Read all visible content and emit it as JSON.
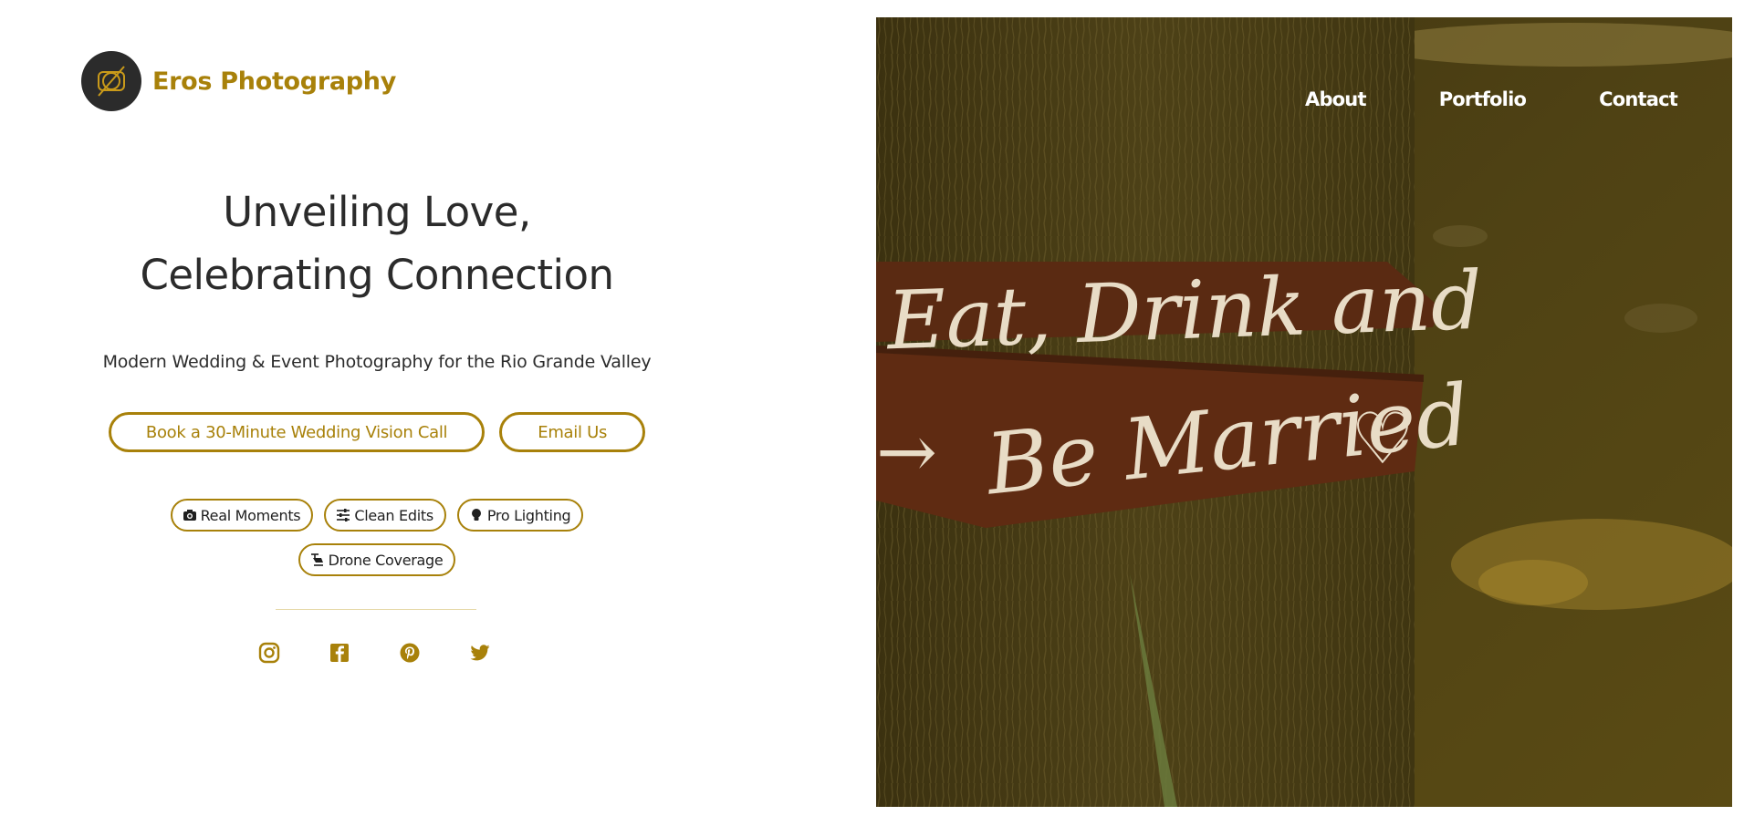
{
  "brand": {
    "name": "Eros Photography",
    "logo_icon": "camera-aperture-icon"
  },
  "hero": {
    "title_line1": "Unveiling Love,",
    "title_line2": "Celebrating Connection",
    "subtitle": "Modern Wedding & Event Photography for the Rio Grande Valley"
  },
  "cta": {
    "primary_label": "Book a 30-Minute Wedding Vision Call",
    "secondary_label": "Email Us"
  },
  "features": [
    {
      "label": "Real Moments",
      "icon": "camera-icon"
    },
    {
      "label": "Clean Edits",
      "icon": "sliders-icon"
    },
    {
      "label": "Pro Lighting",
      "icon": "lightbulb-icon"
    },
    {
      "label": "Drone Coverage",
      "icon": "drone-icon"
    }
  ],
  "social": [
    {
      "network": "Instagram",
      "icon": "instagram-icon"
    },
    {
      "network": "Facebook",
      "icon": "facebook-icon"
    },
    {
      "network": "Pinterest",
      "icon": "pinterest-icon"
    },
    {
      "network": "Twitter",
      "icon": "twitter-icon"
    }
  ],
  "nav": {
    "about": "About",
    "portfolio": "Portfolio",
    "contact": "Contact"
  },
  "photo": {
    "sign_top": "Eat, Drink  and",
    "sign_bottom": "Be Married"
  },
  "colors": {
    "accent": "#a8810a",
    "text": "#2b2b2b",
    "photo_tint": "#4a3d12"
  }
}
